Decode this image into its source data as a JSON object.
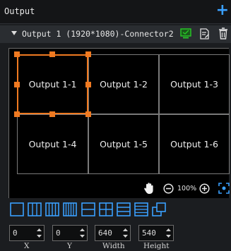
{
  "header": {
    "title": "Output",
    "add_label": "+"
  },
  "output_row": {
    "label": "Output 1 (1920*1080)-Connector2"
  },
  "grid": {
    "cells": [
      "Output 1-1",
      "Output 1-2",
      "Output 1-3",
      "Output 1-4",
      "Output 1-5",
      "Output 1-6"
    ],
    "selected_cell": "Output 1-1"
  },
  "zoom": {
    "value": "100%"
  },
  "colors": {
    "accent": "#f07a21",
    "blue": "#3aa0ff",
    "green": "#27c227"
  },
  "fields": [
    {
      "value": "0",
      "label": "X"
    },
    {
      "value": "0",
      "label": "Y"
    },
    {
      "value": "640",
      "label": "Width"
    },
    {
      "value": "540",
      "label": "Height"
    }
  ]
}
